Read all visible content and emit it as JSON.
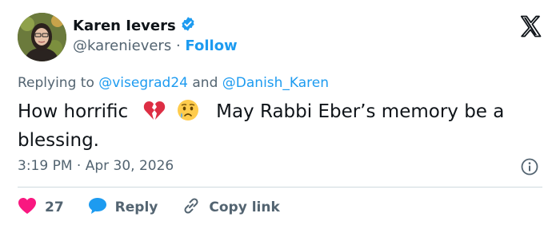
{
  "author": {
    "name": "Karen Ievers",
    "handle": "@karenievers",
    "separator": "·",
    "follow_label": "Follow"
  },
  "reply_context": {
    "prefix": "Replying to",
    "mention_1": "@visegrad24",
    "conjunction": "and",
    "mention_2": "@Danish_Karen"
  },
  "tweet": {
    "text_before_emoji": "How horrific",
    "text_after_emoji": "May Rabbi Eber’s memory be a blessing.",
    "emojis": [
      "broken-heart-icon",
      "crying-face-icon"
    ]
  },
  "meta": {
    "time": "3:19 PM",
    "separator": "·",
    "date": "Apr 30, 2026"
  },
  "actions": {
    "like_count": "27",
    "reply_label": "Reply",
    "copy_label": "Copy link"
  },
  "colors": {
    "accent": "#1d9bf0",
    "like": "#f91880",
    "muted": "#536471",
    "verified": "#1d9bf0"
  }
}
